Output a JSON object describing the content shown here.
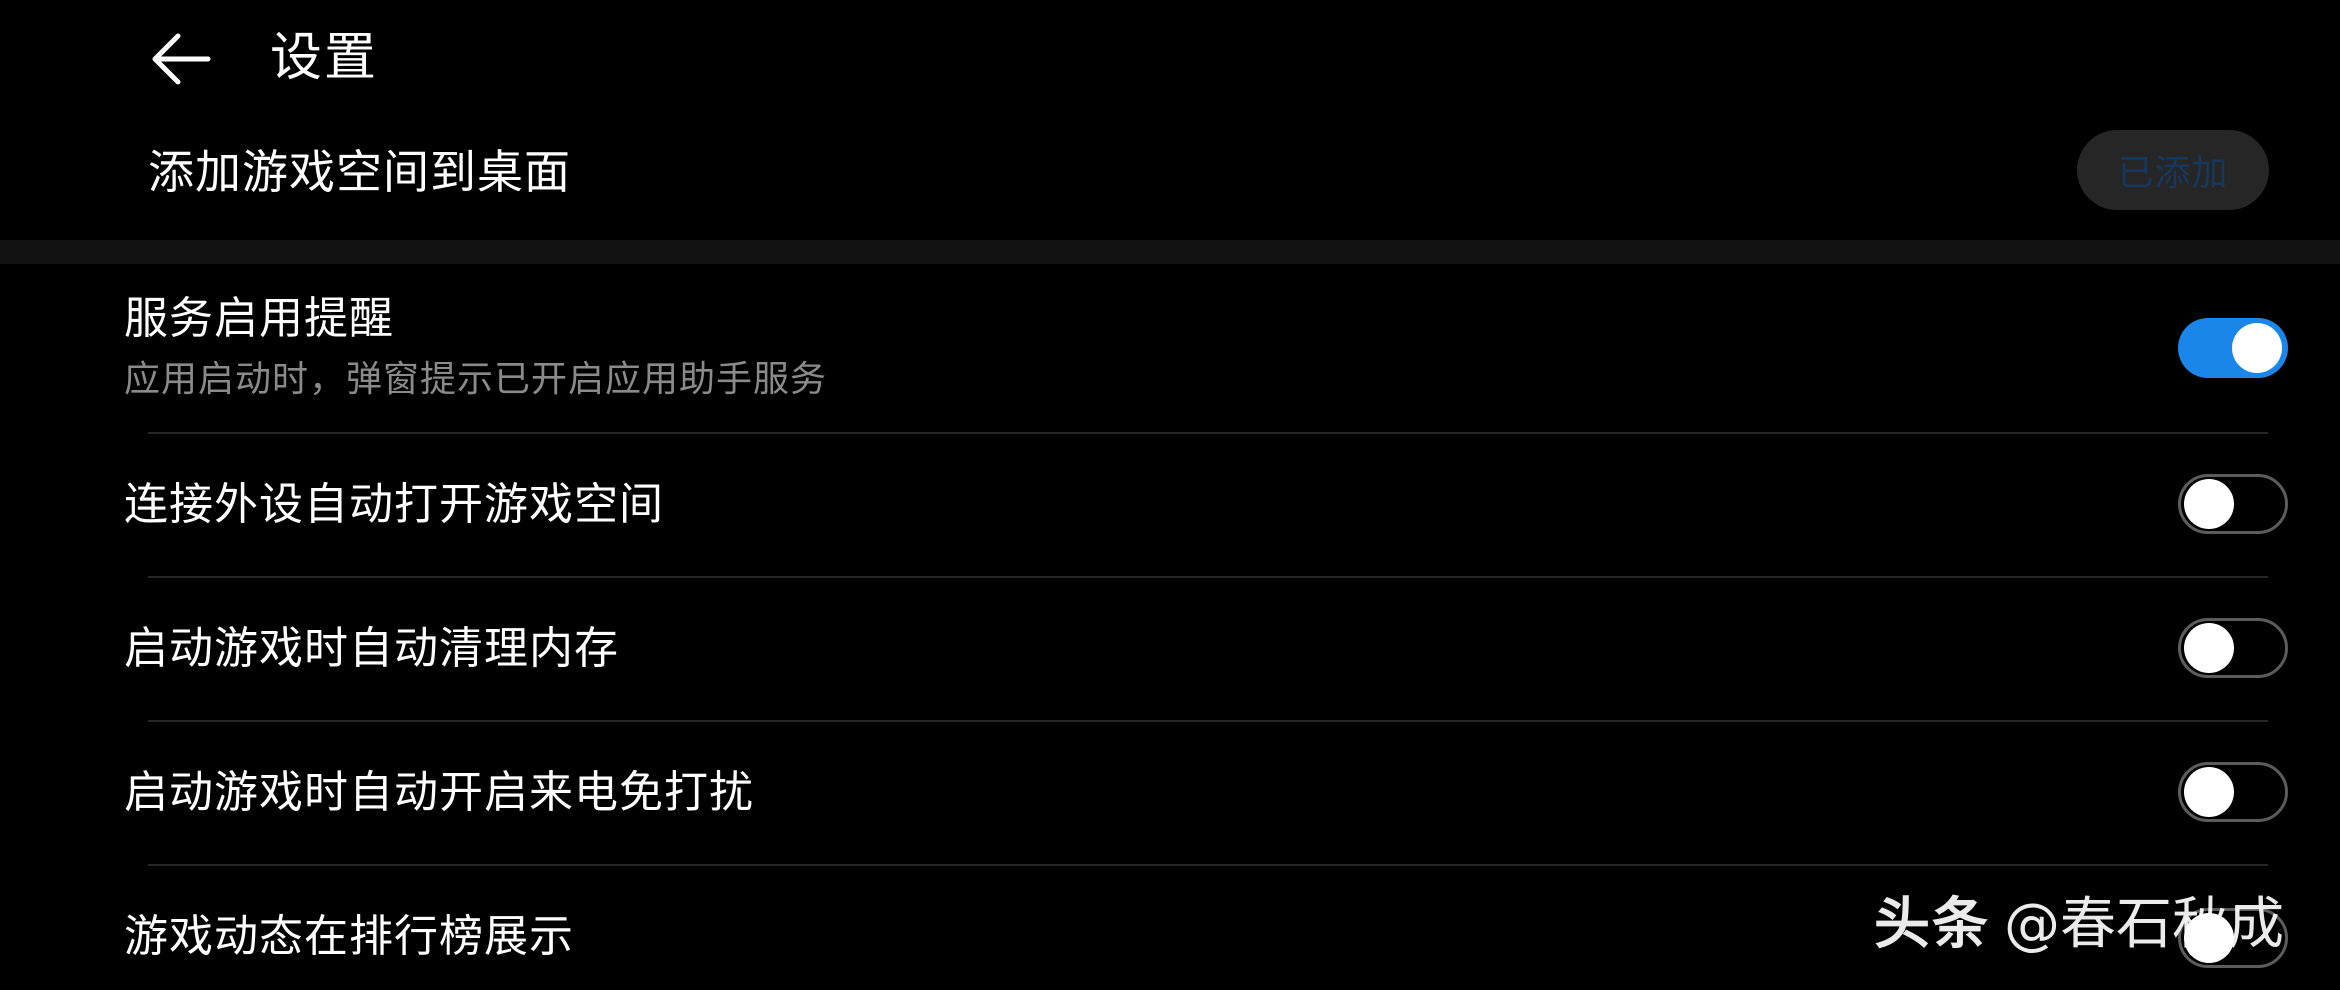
{
  "header": {
    "title": "设置",
    "back_icon": "arrow-left-icon"
  },
  "add_to_desktop": {
    "label": "添加游戏空间到桌面",
    "button_label": "已添加",
    "button_color": "#17375c"
  },
  "settings": [
    {
      "title": "服务启用提醒",
      "subtitle": "应用启动时，弹窗提示已开启应用助手服务",
      "enabled": true
    },
    {
      "title": "连接外设自动打开游戏空间",
      "enabled": false
    },
    {
      "title": "启动游戏时自动清理内存",
      "enabled": false
    },
    {
      "title": "启动游戏时自动开启来电免打扰",
      "enabled": false
    },
    {
      "title": "游戏动态在排行榜展示",
      "enabled": false
    }
  ],
  "colors": {
    "toggle_on": "#1a86ea",
    "toggle_off_border": "#5c5c5c",
    "background": "#000000"
  },
  "watermark": {
    "brand": "头条",
    "handle": "@春石秋成"
  }
}
